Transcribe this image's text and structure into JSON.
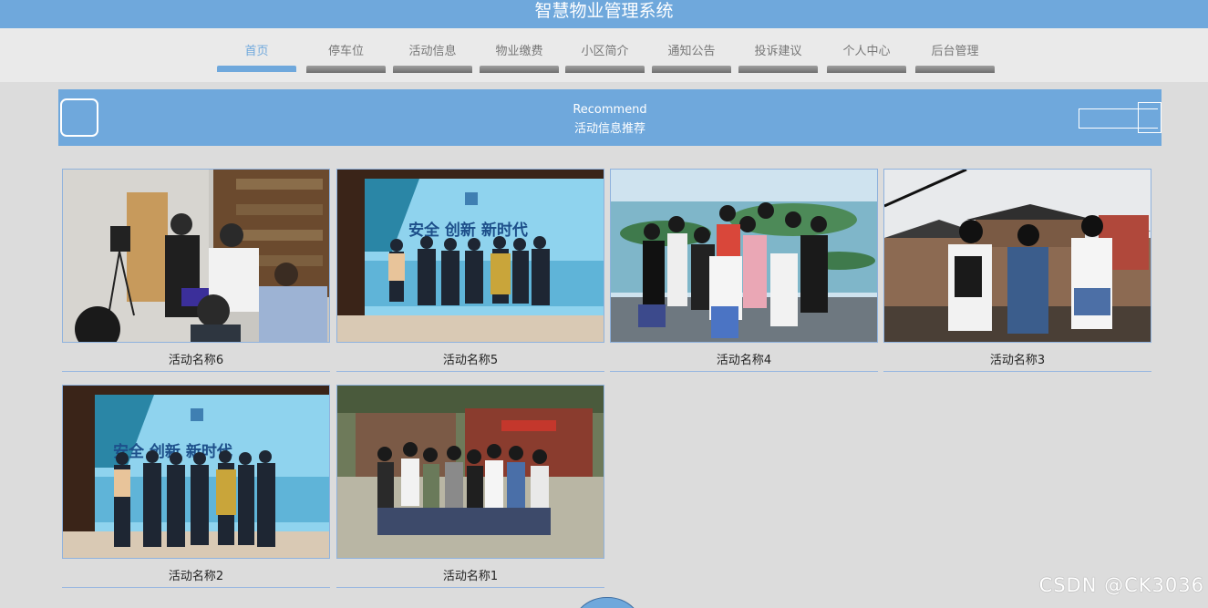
{
  "app_title": "智慧物业管理系统",
  "nav": {
    "items": [
      {
        "label": "首页",
        "active": true
      },
      {
        "label": "停车位",
        "active": false
      },
      {
        "label": "活动信息",
        "active": false
      },
      {
        "label": "物业缴费",
        "active": false
      },
      {
        "label": "小区简介",
        "active": false
      },
      {
        "label": "通知公告",
        "active": false
      },
      {
        "label": "投诉建议",
        "active": false
      },
      {
        "label": "个人中心",
        "active": false
      },
      {
        "label": "后台管理",
        "active": false
      }
    ]
  },
  "banner": {
    "title_en": "Recommend",
    "title_cn": "活动信息推荐"
  },
  "activities": [
    {
      "name": "活动名称6"
    },
    {
      "name": "活动名称5"
    },
    {
      "name": "活动名称4"
    },
    {
      "name": "活动名称3"
    },
    {
      "name": "活动名称2"
    },
    {
      "name": "活动名称1"
    }
  ],
  "watermark": "CSDN @CK3036",
  "colors": {
    "accent": "#6fa8dc",
    "nav_background": "#eaeaea",
    "page_background": "#dcdcdc"
  }
}
